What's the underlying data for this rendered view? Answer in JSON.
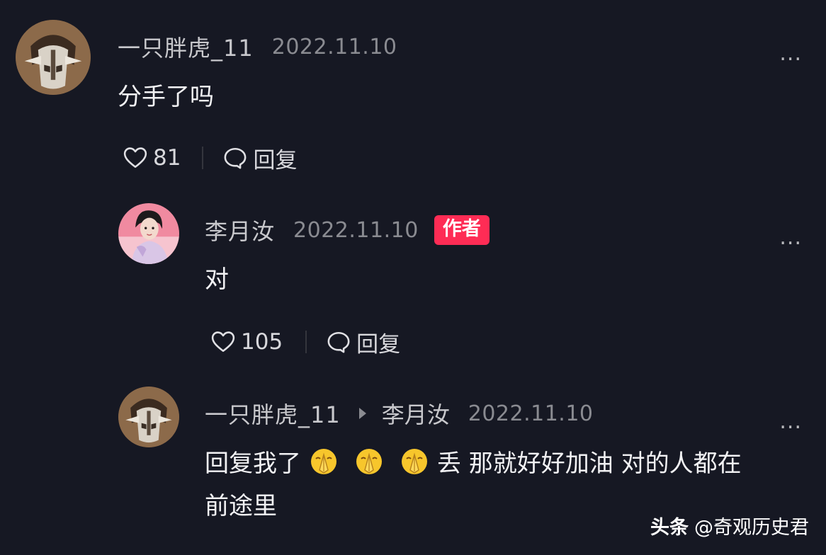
{
  "colors": {
    "background": "#161823",
    "author_badge": "#fe2c55",
    "muted_text": "#8a8b91"
  },
  "comments": [
    {
      "username": "一只胖虎_11",
      "date": "2022.11.10",
      "text": "分手了吗",
      "likes": "81",
      "reply_label": "回复",
      "more": "...",
      "avatar_icon": "masked-character-avatar"
    },
    {
      "username": "李月汝",
      "date": "2022.11.10",
      "badge": "作者",
      "text": "对",
      "likes": "105",
      "reply_label": "回复",
      "more": "...",
      "avatar_icon": "woman-portrait-avatar"
    },
    {
      "username": "一只胖虎_11",
      "reply_to": "李月汝",
      "date": "2022.11.10",
      "text_part1": "回复我了",
      "text_part2": "丢 那就好好加油 对的人都在",
      "text_line2": "前途里",
      "emoji_icon": "praying-emoji",
      "more": "...",
      "avatar_icon": "masked-character-avatar"
    }
  ],
  "watermark": {
    "brand": "头条",
    "account": "@奇观历史君"
  }
}
